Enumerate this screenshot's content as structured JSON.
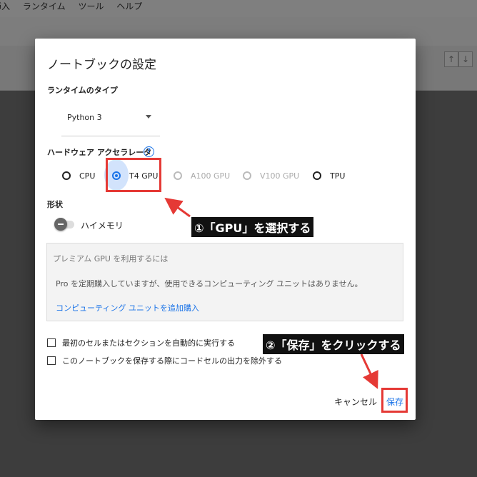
{
  "menubar": {
    "items": [
      "挿入",
      "ランタイム",
      "ツール",
      "ヘルプ"
    ]
  },
  "toolbar": {
    "up_arrow": "↑",
    "down_arrow": "↓"
  },
  "dialog": {
    "title": "ノートブックの設定",
    "runtime_type_label": "ランタイムのタイプ",
    "runtime_value": "Python 3",
    "hw_accel_label": "ハードウェア アクセラレータ",
    "help_symbol": "?",
    "accelerators": [
      {
        "label": "CPU",
        "state": "enabled"
      },
      {
        "label": "T4 GPU",
        "state": "checked"
      },
      {
        "label": "A100 GPU",
        "state": "disabled"
      },
      {
        "label": "V100 GPU",
        "state": "disabled"
      },
      {
        "label": "TPU",
        "state": "enabled"
      }
    ],
    "shape_label": "形状",
    "high_mem_label": "ハイメモリ",
    "premium": {
      "title": "プレミアム GPU を利用するには",
      "text": "Pro を定期購入していますが、使用できるコンピューティング ユニットはありません。",
      "link": "コンピューティング ユニットを追加購入"
    },
    "checkboxes": [
      "最初のセルまたはセクションを自動的に実行する",
      "このノートブックを保存する際にコードセルの出力を除外する"
    ],
    "cancel_label": "キャンセル",
    "save_label": "保存"
  },
  "annotations": {
    "step1": "①「GPU」を選択する",
    "step2": "②「保存」をクリックする"
  },
  "colors": {
    "accent": "#1a73e8",
    "highlight": "#e53935",
    "annotation_bg": "#111111"
  }
}
